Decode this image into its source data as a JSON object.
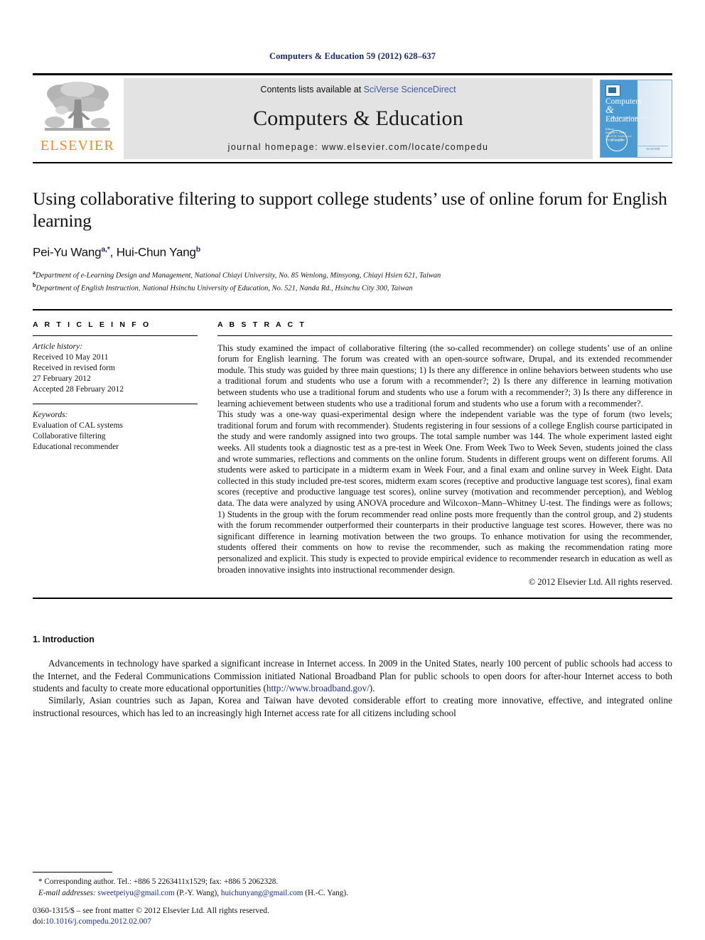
{
  "running_head": "Computers & Education 59 (2012) 628–637",
  "masthead": {
    "publisher_name": "ELSEVIER",
    "contents_prefix": "Contents lists available at ",
    "contents_link": "SciVerse ScienceDirect",
    "journal_name": "Computers & Education",
    "homepage": "journal homepage: www.elsevier.com/locate/compedu",
    "cover": {
      "title_line1": "Computers",
      "title_amp": "&",
      "title_line2": "Education",
      "subtitle": "An International Journal",
      "editors_label": "Editors:",
      "editors_line1": "Rachelle S. Heller",
      "editors_line2": "Jean D.M. Underwood",
      "editors_line3": "Chin-Chung Tsai",
      "seal_text": "IF 2.190"
    }
  },
  "article": {
    "title": "Using collaborative filtering to support college students’ use of online forum for English learning",
    "authors": [
      {
        "name": "Pei-Yu Wang",
        "marks": "a,*"
      },
      {
        "name": "Hui-Chun Yang",
        "marks": "b"
      }
    ],
    "affiliations": [
      {
        "mark": "a",
        "text": "Department of e-Learning Design and Management, National Chiayi University, No. 85 Wenlong, Minsyong, Chiayi Hsien 621, Taiwan"
      },
      {
        "mark": "b",
        "text": "Department of English Instruction, National Hsinchu University of Education, No. 521, Nanda Rd., Hsinchu City 300, Taiwan"
      }
    ]
  },
  "article_info": {
    "heading": "A R T I C L E   I N F O",
    "history_label": "Article history:",
    "history": [
      "Received 10 May 2011",
      "Received in revised form",
      "27 February 2012",
      "Accepted 28 February 2012"
    ],
    "keywords_label": "Keywords:",
    "keywords": [
      "Evaluation of CAL systems",
      "Collaborative filtering",
      "Educational recommender"
    ]
  },
  "abstract": {
    "heading": "A B S T R A C T",
    "paragraphs": [
      "This study examined the impact of collaborative filtering (the so-called recommender) on college students’ use of an online forum for English learning. The forum was created with an open-source software, Drupal, and its extended recommender module. This study was guided by three main questions; 1) Is there any difference in online behaviors between students who use a traditional forum and students who use a forum with a recommender?; 2) Is there any difference in learning motivation between students who use a traditional forum and students who use a forum with a recommender?; 3) Is there any difference in learning achievement between students who use a traditional forum and students who use a forum with a recommender?.",
      "This study was a one-way quasi-experimental design where the independent variable was the type of forum (two levels; traditional forum and forum with recommender). Students registering in four sessions of a college English course participated in the study and were randomly assigned into two groups. The total sample number was 144. The whole experiment lasted eight weeks. All students took a diagnostic test as a pre-test in Week One. From Week Two to Week Seven, students joined the class and wrote summaries, reflections and comments on the online forum. Students in different groups went on different forums. All students were asked to participate in a midterm exam in Week Four, and a final exam and online survey in Week Eight. Data collected in this study included pre-test scores, midterm exam scores (receptive and productive language test scores), final exam scores (receptive and productive language test scores), online survey (motivation and recommender perception), and Weblog data. The data were analyzed by using ANOVA procedure and Wilcoxon–Mann–Whitney U-test. The findings were as follows; 1) Students in the group with the forum recommender read online posts more frequently than the control group, and 2) students with the forum recommender outperformed their counterparts in their productive language test scores. However, there was no significant difference in learning motivation between the two groups. To enhance motivation for using the recommender, students offered their comments on how to revise the recommender, such as making the recommendation rating more personalized and explicit. This study is expected to provide empirical evidence to recommender research in education as well as broaden innovative insights into instructional recommender design."
    ],
    "copyright": "© 2012 Elsevier Ltd. All rights reserved."
  },
  "body": {
    "section_heading": "1. Introduction",
    "paragraph1_before_link": "Advancements in technology have sparked a significant increase in Internet access. In 2009 in the United States, nearly 100 percent of public schools had access to the Internet, and the Federal Communications Commission initiated National Broadband Plan for public schools to open doors for after-hour Internet access to both students and faculty to create more educational opportunities (",
    "paragraph1_link": "http://www.broadband.gov/",
    "paragraph1_after_link": ").",
    "paragraph2": "Similarly, Asian countries such as Japan, Korea and Taiwan have devoted considerable effort to creating more innovative, effective, and integrated online instructional resources, which has led to an increasingly high Internet access rate for all citizens including school"
  },
  "footnotes": {
    "corresponding": "* Corresponding author. Tel.: +886 5 2263411x1529; fax: +886 5 2062328.",
    "email_label": "E-mail addresses:",
    "email1": "sweetpeiyu@gmail.com",
    "email1_owner": "(P.-Y. Wang),",
    "email2": "huichunyang@gmail.com",
    "email2_owner": "(H.-C. Yang)."
  },
  "imprint": {
    "line1": "0360-1315/$ – see front matter © 2012 Elsevier Ltd. All rights reserved.",
    "doi_label": "doi:",
    "doi_value": "10.1016/j.compedu.2012.02.007"
  },
  "colors": {
    "running_head": "#1a2a6c",
    "link_blue": "#1a2a8c",
    "sciencedirect_blue": "#4257a4",
    "elsevier_orange": "#f08a1c",
    "band_gray": "#e3e3e3"
  }
}
